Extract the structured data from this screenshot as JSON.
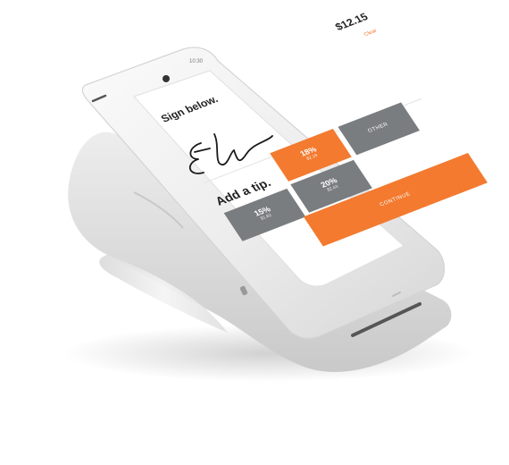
{
  "screen": {
    "amount": "$12.15",
    "title": "Sign below.",
    "clear_label": "Clear",
    "tip_label": "Add a tip.",
    "status_time": "10:30",
    "tips": [
      {
        "percent": "15%",
        "amount": "$1.82",
        "selected": false
      },
      {
        "percent": "18%",
        "amount": "$2.19",
        "selected": true
      },
      {
        "percent": "20%",
        "amount": "$2.43",
        "selected": false
      },
      {
        "percent": "OTHER",
        "amount": "",
        "selected": false
      }
    ],
    "continue_label": "CONTINUE"
  },
  "colors": {
    "accent": "#f37a2f",
    "tip_gray": "#7a7d80",
    "device_white": "#f2f2f2"
  }
}
